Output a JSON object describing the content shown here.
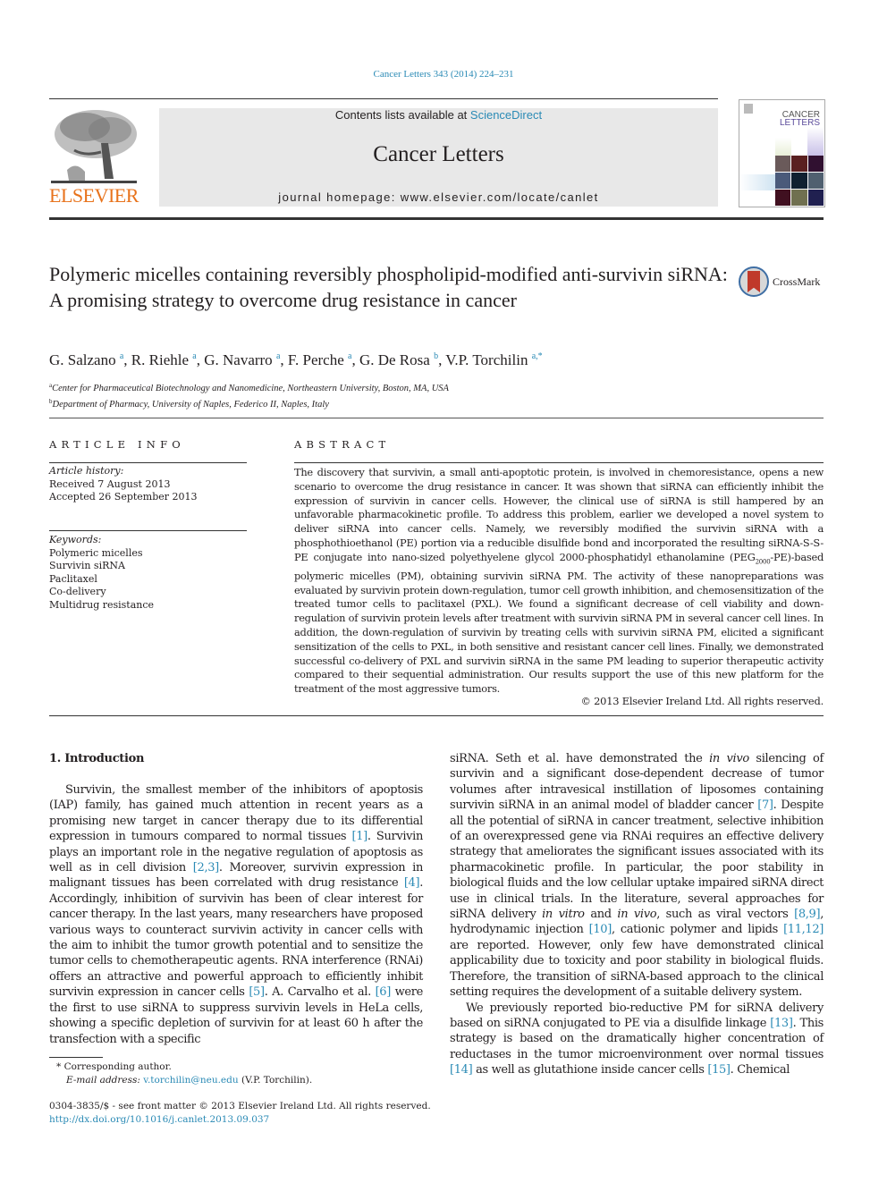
{
  "header": {
    "journal_ref": "Cancer Letters 343 (2014) 224–231",
    "contents_prefix": "Contents lists available at ",
    "contents_link": "ScienceDirect",
    "journal_title": "Cancer Letters",
    "homepage_label": "journal homepage: ",
    "homepage_url": "www.elsevier.com/locate/canlet",
    "publisher_logo_text": "ELSEVIER",
    "cover_title_line1": "CANCER",
    "cover_title_line2": "LETTERS",
    "colors": {
      "link": "#2a8ab5",
      "publisher": "#e8731c",
      "masthead_bg": "#e8e8e8"
    }
  },
  "article": {
    "title": "Polymeric micelles containing reversibly phospholipid-modified anti-survivin siRNA: A promising strategy to overcome drug resistance in cancer",
    "crossmark_label": "CrossMark",
    "authors": [
      {
        "name": "G. Salzano",
        "aff": "a"
      },
      {
        "name": "R. Riehle",
        "aff": "a"
      },
      {
        "name": "G. Navarro",
        "aff": "a"
      },
      {
        "name": "F. Perche",
        "aff": "a"
      },
      {
        "name": "G. De Rosa",
        "aff": "b"
      },
      {
        "name": "V.P. Torchilin",
        "aff": "a,*"
      }
    ],
    "affiliations": [
      {
        "key": "a",
        "text": "Center for Pharmaceutical Biotechnology and Nanomedicine, Northeastern University, Boston, MA, USA"
      },
      {
        "key": "b",
        "text": "Department of Pharmacy, University of Naples, Federico II, Naples, Italy"
      }
    ]
  },
  "article_info": {
    "heading": "ARTICLE INFO",
    "history_label": "Article history:",
    "received": "Received 7 August 2013",
    "accepted": "Accepted 26 September 2013",
    "keywords_label": "Keywords:",
    "keywords": [
      "Polymeric micelles",
      "Survivin siRNA",
      "Paclitaxel",
      "Co-delivery",
      "Multidrug resistance"
    ]
  },
  "abstract": {
    "heading": "ABSTRACT",
    "text_part1": "The discovery that survivin, a small anti-apoptotic protein, is involved in chemoresistance, opens a new scenario to overcome the drug resistance in cancer. It was shown that siRNA can efficiently inhibit the expression of survivin in cancer cells. However, the clinical use of siRNA is still hampered by an unfavorable pharmacokinetic profile. To address this problem, earlier we developed a novel system to deliver siRNA into cancer cells. Namely, we reversibly modified the survivin siRNA with a phosphothioethanol (PE) portion via a reducible disulfide bond and incorporated the resulting siRNA-S-S-PE conjugate into nano-sized polyethyelene glycol 2000-phosphatidyl ethanolamine (PEG",
    "text_sub": "2000",
    "text_part2": "-PE)-based polymeric micelles (PM), obtaining survivin siRNA PM. The activity of these nanopreparations was evaluated by survivin protein down-regulation, tumor cell growth inhibition, and chemosensitization of the treated tumor cells to paclitaxel (PXL). We found a significant decrease of cell viability and down-regulation of survivin protein levels after treatment with survivin siRNA PM in several cancer cell lines. In addition, the down-regulation of survivin by treating cells with survivin siRNA PM, elicited a significant sensitization of the cells to PXL, in both sensitive and resistant cancer cell lines. Finally, we demonstrated successful co-delivery of PXL and survivin siRNA in the same PM leading to superior therapeutic activity compared to their sequential administration. Our results support the use of this new platform for the treatment of the most aggressive tumors.",
    "copyright": "© 2013 Elsevier Ireland Ltd. All rights reserved."
  },
  "body": {
    "section_heading": "1. Introduction",
    "left": {
      "p1": [
        {
          "t": "Survivin, the smallest member of the inhibitors of apoptosis (IAP) family, has gained much attention in recent years as a promising new target in cancer therapy due to its differential expression in tumours compared to normal tissues "
        },
        {
          "c": "[1]"
        },
        {
          "t": ". Survivin plays an important role in the negative regulation of apoptosis as well as in cell division "
        },
        {
          "c": "[2,3]"
        },
        {
          "t": ". Moreover, survivin expression in malignant tissues has been correlated with drug resistance "
        },
        {
          "c": "[4]"
        },
        {
          "t": ". Accordingly, inhibition of survivin has been of clear interest for cancer therapy. In the last years, many researchers have proposed various ways to counteract survivin activity in cancer cells with the aim to inhibit the tumor growth potential and to sensitize the tumor cells to chemotherapeutic agents. RNA interference (RNAi) offers an attractive and powerful approach to efficiently inhibit survivin expression in cancer cells "
        },
        {
          "c": "[5]"
        },
        {
          "t": ". A. Carvalho et al. "
        },
        {
          "c": "[6]"
        },
        {
          "t": " were the first to use siRNA to suppress survivin levels in HeLa cells, showing a specific depletion of survivin for at least 60 h after the transfection with a specific"
        }
      ]
    },
    "right": {
      "p1": [
        {
          "t": "siRNA. Seth et al. have demonstrated the "
        },
        {
          "i": "in vivo"
        },
        {
          "t": " silencing of survivin and a significant dose-dependent decrease of tumor volumes after intravesical instillation of liposomes containing survivin siRNA in an animal model of bladder cancer "
        },
        {
          "c": "[7]"
        },
        {
          "t": ". Despite all the potential of siRNA in cancer treatment, selective inhibition of an overexpressed gene via RNAi requires an effective delivery strategy that ameliorates the significant issues associated with its pharmacokinetic profile. In particular, the poor stability in biological fluids and the low cellular uptake impaired siRNA direct use in clinical trials. In the literature, several approaches for siRNA delivery "
        },
        {
          "i": "in vitro"
        },
        {
          "t": " and "
        },
        {
          "i": "in vivo"
        },
        {
          "t": ", such as viral vectors "
        },
        {
          "c": "[8,9]"
        },
        {
          "t": ", hydrodynamic injection "
        },
        {
          "c": "[10]"
        },
        {
          "t": ", cationic polymer and lipids "
        },
        {
          "c": "[11,12]"
        },
        {
          "t": " are reported. However, only few have demonstrated clinical applicability due to toxicity and poor stability in biological fluids. Therefore, the transition of siRNA-based approach to the clinical setting requires the development of a suitable delivery system."
        }
      ],
      "p2": [
        {
          "t": "We previously reported bio-reductive PM for siRNA delivery based on siRNA conjugated to PE via a disulfide linkage "
        },
        {
          "c": "[13]"
        },
        {
          "t": ". This strategy is based on the dramatically higher concentration of reductases in the tumor microenvironment over normal tissues "
        },
        {
          "c": "[14]"
        },
        {
          "t": " as well as glutathione inside cancer cells "
        },
        {
          "c": "[15]"
        },
        {
          "t": ". Chemical"
        }
      ]
    }
  },
  "footnotes": {
    "star": "*",
    "corresponding": "Corresponding author.",
    "email_label": "E-mail address:",
    "email": "v.torchilin@neu.edu",
    "email_suffix": "(V.P. Torchilin).",
    "front_matter": "0304-3835/$ - see front matter © 2013 Elsevier Ireland Ltd. All rights reserved.",
    "doi": "http://dx.doi.org/10.1016/j.canlet.2013.09.037"
  }
}
